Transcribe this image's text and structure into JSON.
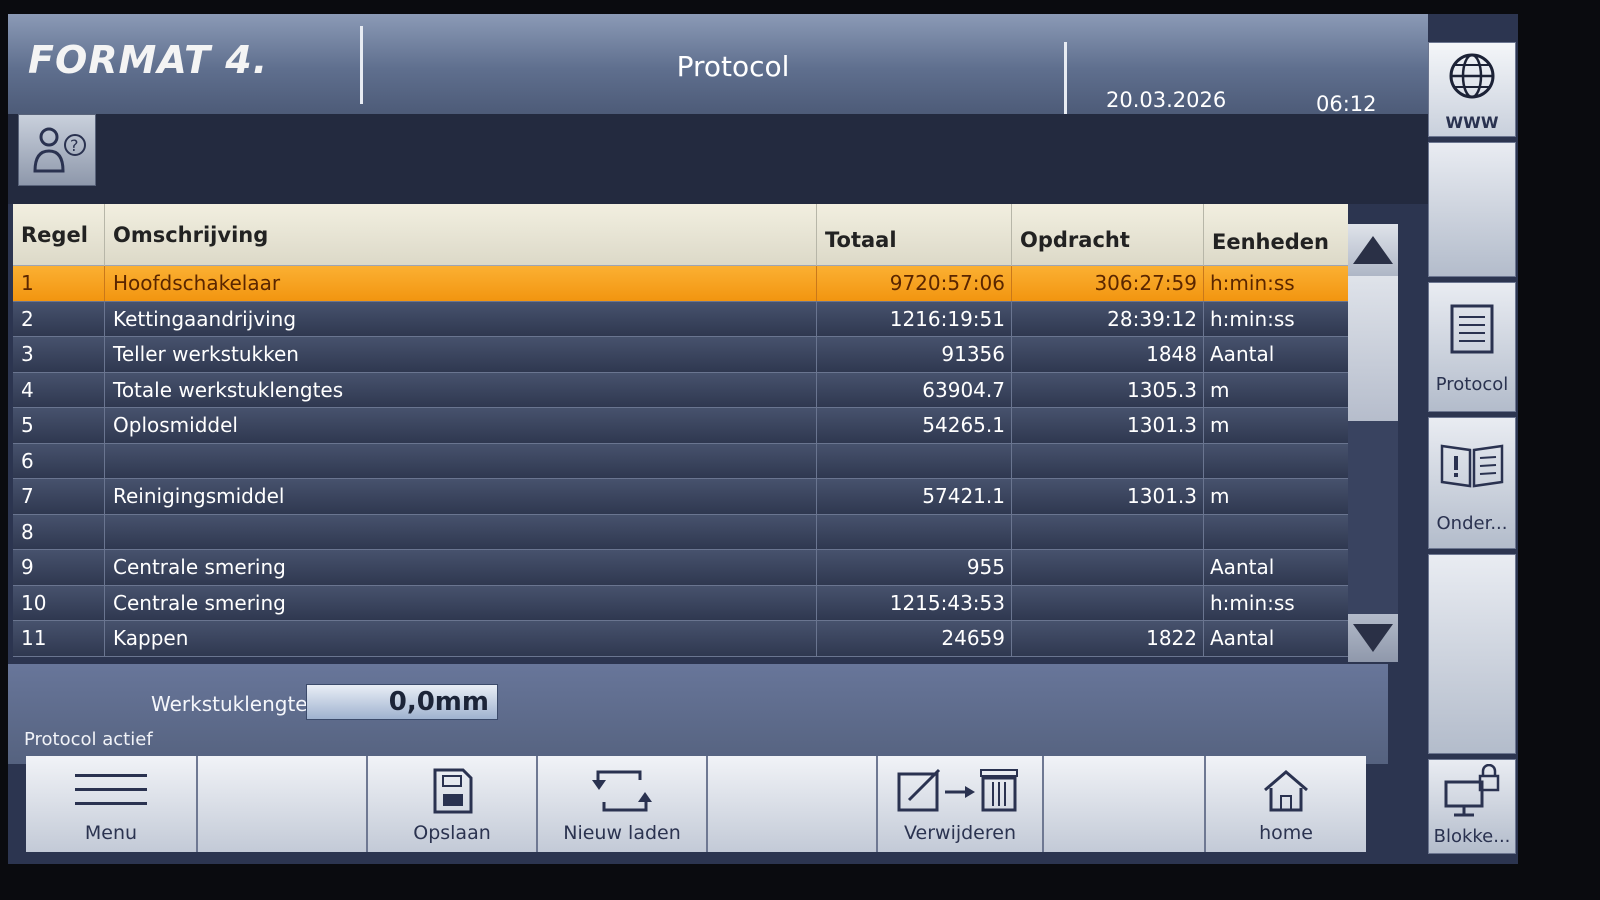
{
  "header": {
    "logo": "FORMAT 4.",
    "title": "Protocol",
    "date": "20.03.2026",
    "time": "06:12"
  },
  "sidebar": {
    "www_label": "WWW",
    "protocol_label": "Protocol",
    "onder_label": "Onder...",
    "blokke_label": "Blokke..."
  },
  "table": {
    "headers": {
      "regel": "Regel",
      "omschrijving": "Omschrijving",
      "totaal": "Totaal",
      "opdracht": "Opdracht",
      "eenheden": "Eenheden"
    },
    "rows": [
      {
        "regel": "1",
        "omschrijving": "Hoofdschakelaar",
        "totaal": "9720:57:06",
        "opdracht": "306:27:59",
        "eenheden": "h:min:ss"
      },
      {
        "regel": "2",
        "omschrijving": "Kettingaandrijving",
        "totaal": "1216:19:51",
        "opdracht": "28:39:12",
        "eenheden": "h:min:ss"
      },
      {
        "regel": "3",
        "omschrijving": "Teller werkstukken",
        "totaal": "91356",
        "opdracht": "1848",
        "eenheden": "Aantal"
      },
      {
        "regel": "4",
        "omschrijving": "Totale werkstuklengtes",
        "totaal": "63904.7",
        "opdracht": "1305.3",
        "eenheden": "m"
      },
      {
        "regel": "5",
        "omschrijving": "Oplosmiddel",
        "totaal": "54265.1",
        "opdracht": "1301.3",
        "eenheden": "m"
      },
      {
        "regel": "6",
        "omschrijving": "",
        "totaal": "",
        "opdracht": "",
        "eenheden": ""
      },
      {
        "regel": "7",
        "omschrijving": "Reinigingsmiddel",
        "totaal": "57421.1",
        "opdracht": "1301.3",
        "eenheden": "m"
      },
      {
        "regel": "8",
        "omschrijving": "",
        "totaal": "",
        "opdracht": "",
        "eenheden": ""
      },
      {
        "regel": "9",
        "omschrijving": "Centrale smering",
        "totaal": "955",
        "opdracht": "",
        "eenheden": "Aantal"
      },
      {
        "regel": "10",
        "omschrijving": "Centrale smering",
        "totaal": "1215:43:53",
        "opdracht": "",
        "eenheden": "h:min:ss"
      },
      {
        "regel": "11",
        "omschrijving": "Kappen",
        "totaal": "24659",
        "opdracht": "1822",
        "eenheden": "Aantal"
      }
    ]
  },
  "info": {
    "werkstuklengte_label": "Werkstuklengte",
    "werkstuklengte_value": "0,0mm",
    "status": "Protocol actief"
  },
  "toolbar": {
    "menu": "Menu",
    "opslaan": "Opslaan",
    "nieuw_laden": "Nieuw laden",
    "verwijderen": "Verwijderen",
    "home": "home"
  },
  "colors": {
    "selected_row": "#f6a020",
    "header_bg": "#6e7d9c",
    "table_header_bg": "#ebe8d8",
    "row_bg": "#3b455f"
  }
}
